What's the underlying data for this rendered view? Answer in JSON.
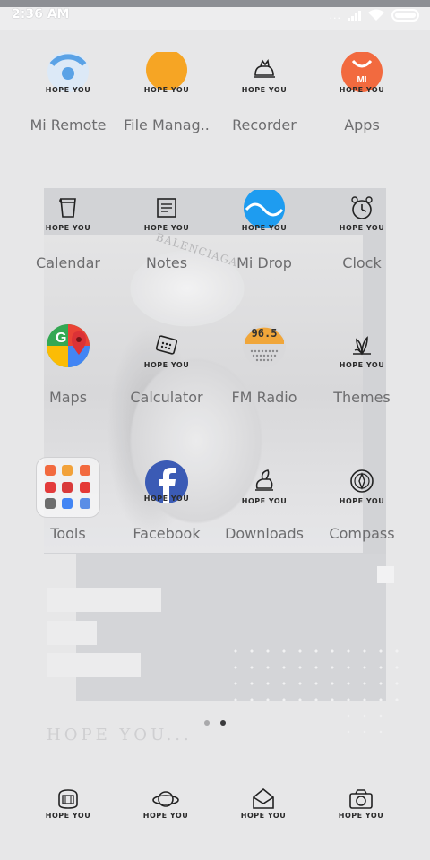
{
  "status_bar": {
    "time": "2:36 AM",
    "dots": "..."
  },
  "apps": [
    {
      "label": "Mi Remote",
      "tag": "HOPE YOU",
      "icon": "mi-remote-icon",
      "color": "#5aa2e6"
    },
    {
      "label": "File Manag..",
      "tag": "HOPE YOU",
      "icon": "file-manager-icon",
      "color": "#f6a524"
    },
    {
      "label": "Recorder",
      "tag": "HOPE YOU",
      "icon": "recorder-icon"
    },
    {
      "label": "Apps",
      "tag": "HOPE YOU",
      "icon": "apps-icon",
      "color": "#f26a3f"
    },
    {
      "label": "Calendar",
      "tag": "HOPE YOU",
      "icon": "calendar-icon"
    },
    {
      "label": "Notes",
      "tag": "HOPE YOU",
      "icon": "notes-icon"
    },
    {
      "label": "Mi Drop",
      "tag": "HOPE YOU",
      "icon": "mi-drop-icon",
      "color": "#1e9cf0"
    },
    {
      "label": "Clock",
      "tag": "HOPE YOU",
      "icon": "clock-icon"
    },
    {
      "label": "Maps",
      "tag": "HOPE YOU",
      "icon": "maps-icon"
    },
    {
      "label": "Calculator",
      "tag": "HOPE YOU",
      "icon": "calculator-icon"
    },
    {
      "label": "FM Radio",
      "tag": "96.5",
      "icon": "fm-radio-icon",
      "color": "#f0a63a"
    },
    {
      "label": "Themes",
      "tag": "HOPE YOU",
      "icon": "themes-icon"
    },
    {
      "label": "Tools",
      "tag": "",
      "icon": "tools-folder-icon"
    },
    {
      "label": "Facebook",
      "tag": "HOPE YOU",
      "icon": "facebook-icon",
      "color": "#3b5bb5"
    },
    {
      "label": "Downloads",
      "tag": "HOPE YOU",
      "icon": "downloads-icon"
    },
    {
      "label": "Compass",
      "tag": "HOPE YOU",
      "icon": "compass-icon"
    }
  ],
  "folder_colors": [
    "#f26a3f",
    "#f2a23a",
    "#f26a3f",
    "#e33b3b",
    "#d93a3a",
    "#e53935",
    "#6d6d6d",
    "#4285f4",
    "#5b8ee6"
  ],
  "dock": [
    {
      "tag": "HOPE YOU",
      "icon": "phone-icon"
    },
    {
      "tag": "HOPE YOU",
      "icon": "browser-planet-icon"
    },
    {
      "tag": "HOPE YOU",
      "icon": "messages-envelope-icon"
    },
    {
      "tag": "HOPE YOU",
      "icon": "camera-icon"
    }
  ],
  "wallpaper": {
    "hope_text": "HOPE YOU...",
    "photo_text": "BALENCIAGA"
  },
  "page_indicator": {
    "pages": 2,
    "current": 2
  }
}
